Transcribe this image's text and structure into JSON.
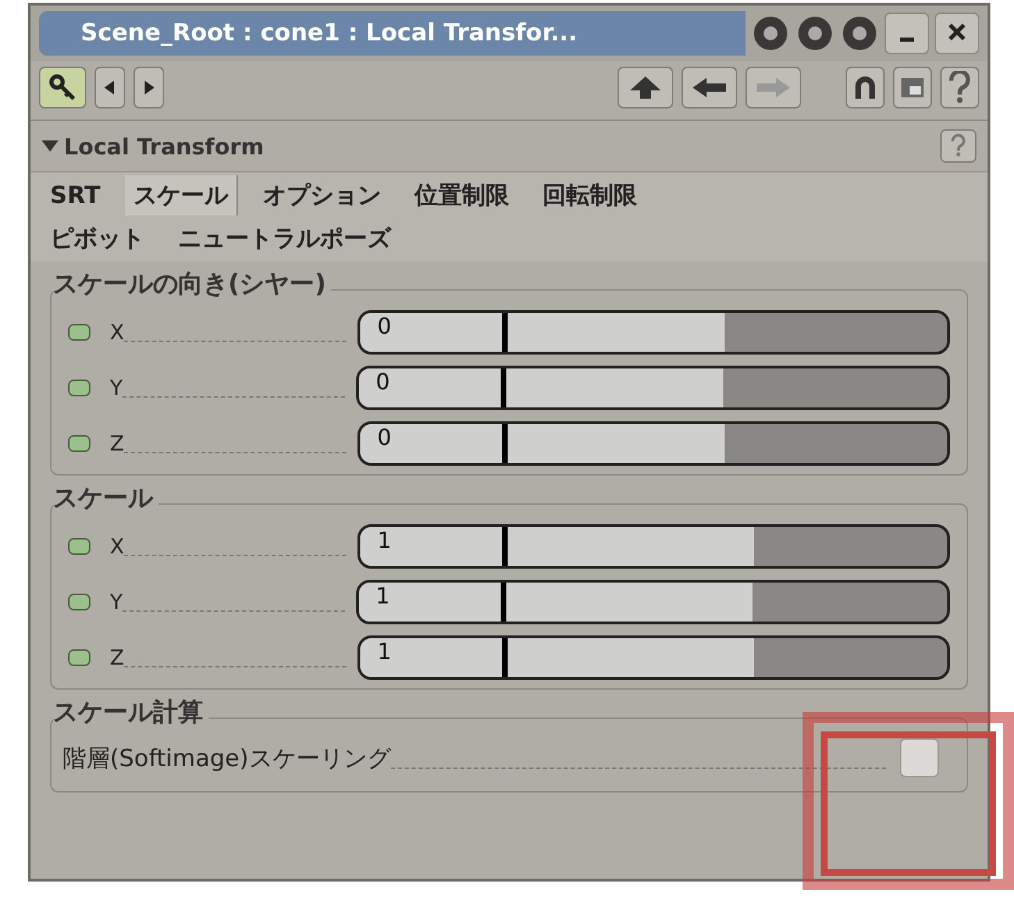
{
  "window": {
    "title": "Scene_Root : cone1 : Local Transfor..."
  },
  "section": {
    "title": "Local Transform",
    "expanded": true
  },
  "tabs": [
    {
      "label": "SRT",
      "selected": false
    },
    {
      "label": "スケール",
      "selected": true
    },
    {
      "label": "オプション",
      "selected": false
    },
    {
      "label": "位置制限",
      "selected": false
    },
    {
      "label": "回転制限",
      "selected": false
    },
    {
      "label": "ピボット",
      "selected": false
    },
    {
      "label": "ニュートラルポーズ",
      "selected": false
    }
  ],
  "groups": [
    {
      "title": "スケールの向き(シヤー)",
      "rows": [
        {
          "label": "X",
          "value": "0",
          "level": 0.62
        },
        {
          "label": "Y",
          "value": "0",
          "level": 0.62
        },
        {
          "label": "Z",
          "value": "0",
          "level": 0.62
        }
      ]
    },
    {
      "title": "スケール",
      "rows": [
        {
          "label": "X",
          "value": "1",
          "level": 0.67
        },
        {
          "label": "Y",
          "value": "1",
          "level": 0.67
        },
        {
          "label": "Z",
          "value": "1",
          "level": 0.67
        }
      ]
    }
  ],
  "calc": {
    "title": "スケール計算",
    "label": "階層(Softimage)スケーリング",
    "checked": false
  }
}
